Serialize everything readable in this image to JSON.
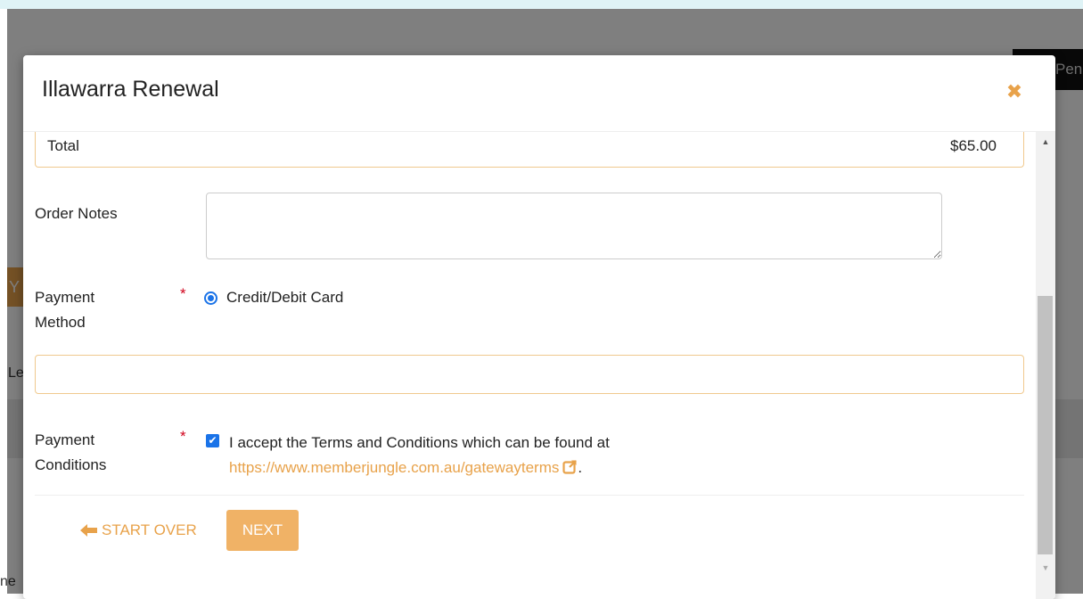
{
  "background": {
    "chip_text": "Pen",
    "orange_chip_text": "Y",
    "left_text": "Le",
    "bottom_text": "ne"
  },
  "modal": {
    "title": "Illawarra Renewal",
    "close_icon": "times-icon",
    "total": {
      "label": "Total",
      "value": "$65.00"
    },
    "order_notes": {
      "label": "Order Notes",
      "value": "",
      "placeholder": ""
    },
    "payment_method": {
      "label": "Payment Method",
      "required_mark": "*",
      "option_label": "Credit/Debit Card",
      "selected": true
    },
    "card_details": {
      "value": ""
    },
    "payment_conditions": {
      "label": "Payment Conditions",
      "required_mark": "*",
      "checked": true,
      "text": "I accept the Terms and Conditions which can be found at",
      "link_text": "https://www.memberjungle.com.au/gatewayterms",
      "link_icon": "external-link-icon",
      "trailing": "."
    },
    "buttons": {
      "start_over": "START OVER",
      "start_over_icon": "arrow-left-icon",
      "next": "NEXT"
    }
  },
  "colors": {
    "accent": "#e8a24a",
    "button": "#f0b266",
    "radio": "#1a73e8",
    "required": "#d0021b"
  }
}
